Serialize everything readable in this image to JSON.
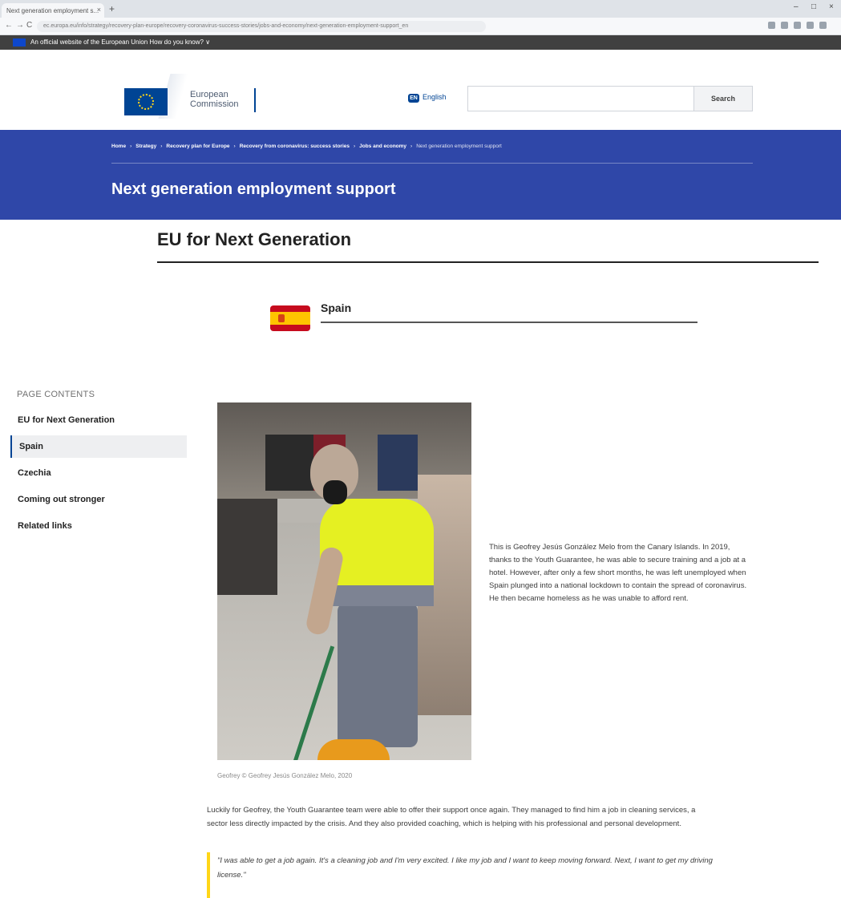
{
  "browser": {
    "tab_title": "Next generation employment s...",
    "tab_close": "×",
    "new_tab": "+",
    "url": "ec.europa.eu/info/strategy/recovery-plan-europe/recovery-coronavirus-success-stories/jobs-and-economy/next-generation-employment-support_en",
    "back": "←",
    "forward": "→",
    "reload": "C",
    "minimize": "–",
    "maximize": "□",
    "close": "×"
  },
  "eu_banner": {
    "text": "An official website of the European Union   How do you know? ∨"
  },
  "header": {
    "logo_line1": "European",
    "logo_line2": "Commission",
    "lang_code": "EN",
    "lang_label": "English",
    "search_placeholder": "",
    "search_button": "Search"
  },
  "breadcrumbs": [
    "Home",
    "Strategy",
    "Recovery plan for Europe",
    "Recovery from coronavirus: success stories",
    "Jobs and economy",
    "Next generation employment support"
  ],
  "page_title": "Next generation employment support",
  "section_title": "EU for Next Generation",
  "country_title": "Spain",
  "sidebar": {
    "heading": "PAGE CONTENTS",
    "items": [
      {
        "label": "EU for Next Generation"
      },
      {
        "label": "Spain"
      },
      {
        "label": "Czechia"
      },
      {
        "label": "Coming out stronger"
      },
      {
        "label": "Related links"
      }
    ],
    "active_index": 1
  },
  "photo_caption": "Geofrey © Geofrey Jesús González Melo, 2020",
  "side_paragraph": "This is Geofrey Jesús González Melo from the Canary Islands. In 2019, thanks to the Youth Guarantee, he was able to secure training and a job at a hotel. However, after only a few short months, he was left unemployed when Spain plunged into a national lockdown to contain the spread of coronavirus. He then became homeless as he was unable to afford rent.",
  "body_paragraph": "Luckily for Geofrey, the Youth Guarantee team were able to offer their support once again. They managed to find him a job in cleaning services, a sector less directly impacted by the crisis. And they also provided coaching, which is helping with his professional and personal development.",
  "quote": "\"I was able to get a job again. It's a cleaning job and I'm very excited. I like my job and I want to keep moving forward. Next, I want to get my driving license.\"",
  "colors": {
    "brand_blue": "#004494",
    "band_blue": "#2f47a8",
    "eu_yellow": "#ffd617",
    "spain_red": "#c60b1e",
    "spain_yellow": "#ffc400"
  }
}
